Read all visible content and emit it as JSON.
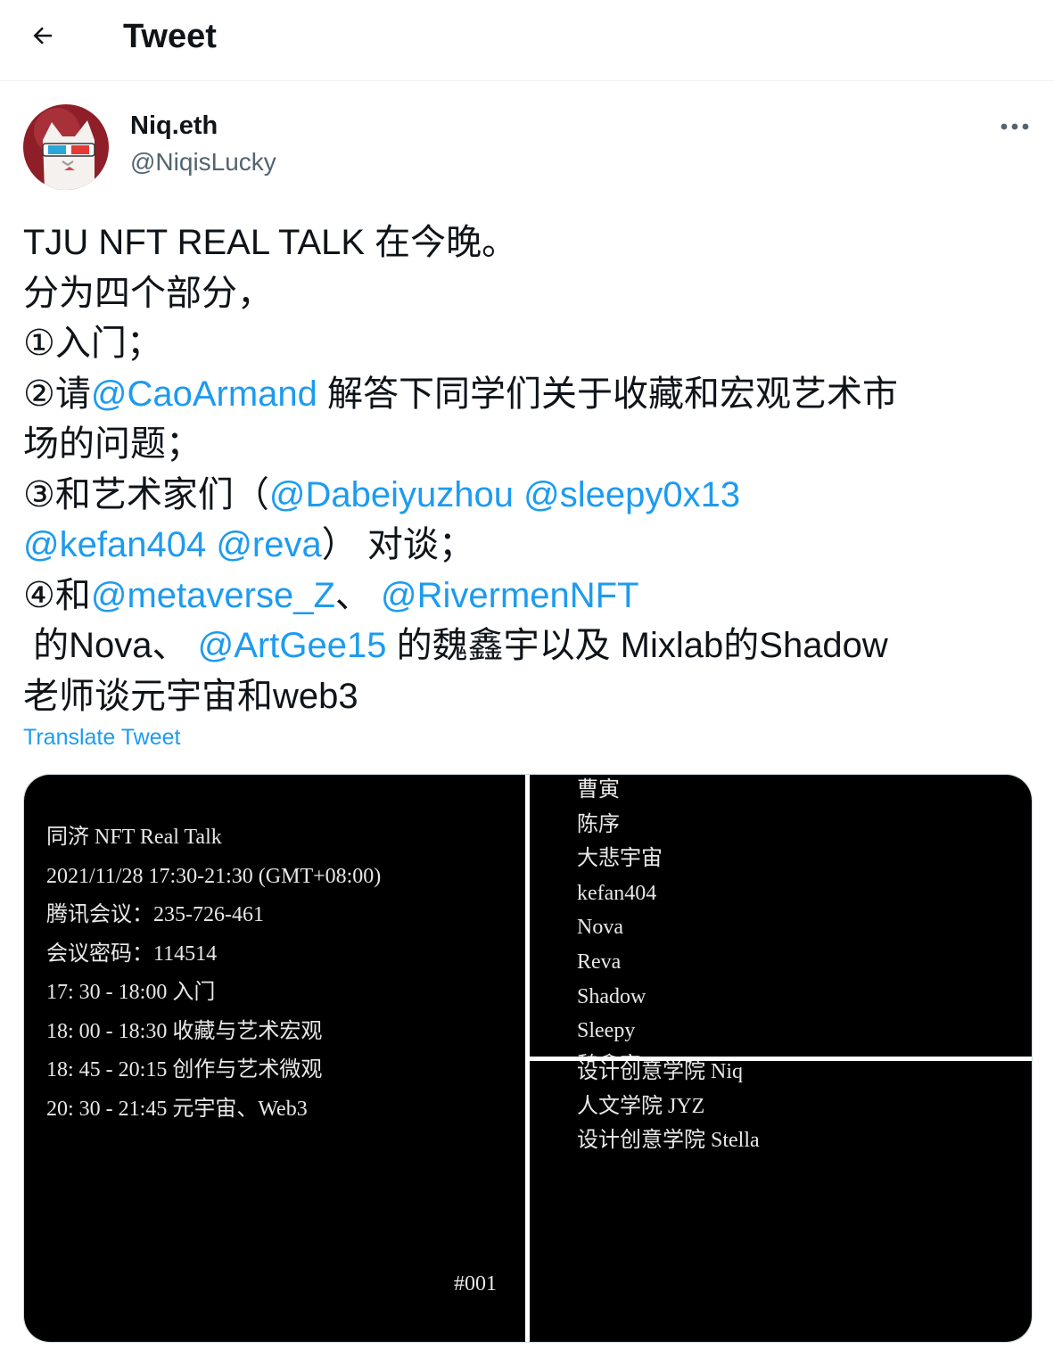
{
  "header": {
    "title": "Tweet",
    "back_icon": "arrow-left-icon"
  },
  "author": {
    "name": "Niq.eth",
    "handle": "@NiqisLucky",
    "avatar_icon": "avatar-cat-3d-glasses"
  },
  "tweet": {
    "lines": [
      [
        {
          "t": "TJU NFT REAL TALK 在今晚。"
        }
      ],
      [
        {
          "t": "分为四个部分，"
        }
      ],
      [
        {
          "t": "①入门；"
        }
      ],
      [
        {
          "t": "②请"
        },
        {
          "t": "@CaoArmand",
          "m": 1
        },
        {
          "t": " 解答下同学们关于收藏和宏观艺术市"
        }
      ],
      [
        {
          "t": "场的问题；"
        }
      ],
      [
        {
          "t": "③和艺术家们（"
        },
        {
          "t": "@Dabeiyuzhou",
          "m": 1
        },
        {
          "t": " "
        },
        {
          "t": "@sleepy0x13",
          "m": 1
        }
      ],
      [
        {
          "t": "@kefan404",
          "m": 1
        },
        {
          "t": " "
        },
        {
          "t": "@reva",
          "m": 1
        },
        {
          "t": "） 对谈；"
        }
      ],
      [
        {
          "t": "④和"
        },
        {
          "t": "@metaverse_Z",
          "m": 1
        },
        {
          "t": "、 "
        },
        {
          "t": "@RivermenNFT",
          "m": 1
        }
      ],
      [
        {
          "t": " 的Nova、 "
        },
        {
          "t": "@ArtGee15",
          "m": 1
        },
        {
          "t": " 的魏鑫宇以及 Mixlab的Shadow"
        }
      ],
      [
        {
          "t": "老师谈元宇宙和web3"
        }
      ]
    ],
    "translate_label": "Translate Tweet",
    "more_icon": "more-horizontal-icon"
  },
  "media": {
    "left": {
      "lines": [
        "同济 NFT Real Talk",
        "2021/11/28 17:30-21:30 (GMT+08:00)",
        "腾讯会议：235-726-461",
        "会议密码：114514",
        "17: 30 - 18:00 入门",
        "18: 00 - 18:30 收藏与艺术宏观",
        "18: 45 - 20:15 创作与艺术微观",
        "20: 30 - 21:45 元宇宙、Web3"
      ],
      "tag": "#001"
    },
    "top_right": {
      "lines": [
        "曹寅",
        "陈序",
        "大悲宇宙",
        "kefan404",
        "Nova",
        "Reva",
        "Shadow",
        "Sleepy",
        "魏鑫宇"
      ]
    },
    "bottom_right": {
      "lines": [
        "设计创意学院 Niq",
        "人文学院 JYZ",
        "设计创意学院 Stella"
      ]
    }
  },
  "colors": {
    "link": "#1d9bf0",
    "text": "#0f1419",
    "secondary": "#536471"
  }
}
